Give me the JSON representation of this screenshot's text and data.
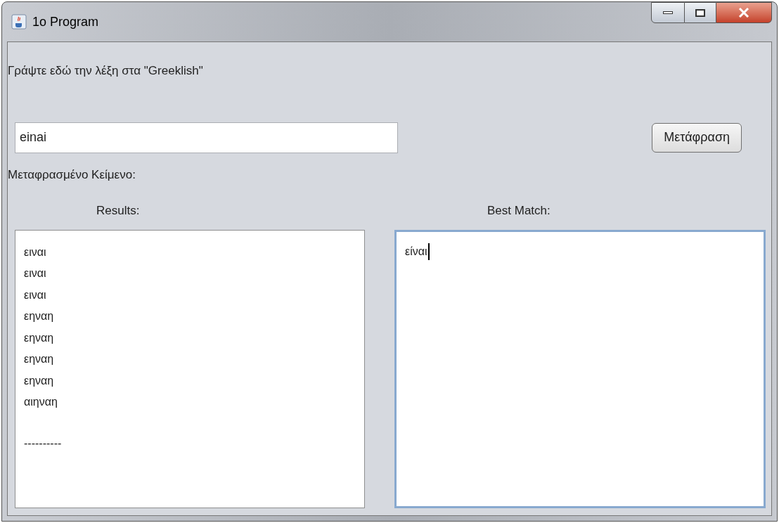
{
  "window": {
    "title": "1o Program"
  },
  "prompt": "Γράψτε εδώ την λέξη στα \"Greeklish\"",
  "input": {
    "value": "einai"
  },
  "translate_button": "Μετάφραση",
  "output_label": "Μεταφρασμένο Κείμενο:",
  "results": {
    "label": "Results:",
    "lines": [
      "ειναι",
      "ειναι",
      "ειναι",
      "εηναη",
      "εηναη",
      "εηναη",
      "εηναη",
      "αιηναη"
    ],
    "separator": "----------"
  },
  "best_match": {
    "label": "Best Match:",
    "value": "είναι",
    "focused": true
  }
}
